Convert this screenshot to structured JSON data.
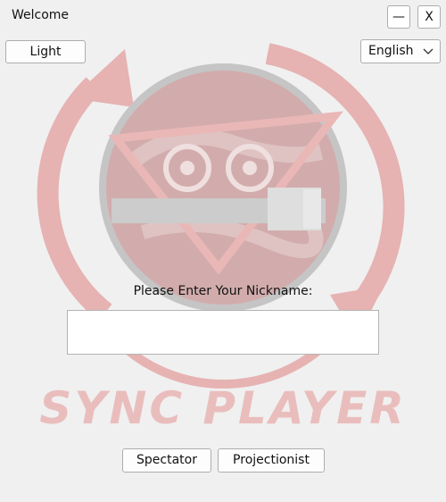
{
  "window": {
    "title": "Welcome",
    "minimize_label": "—",
    "close_label": "X"
  },
  "toolbar": {
    "theme_button_label": "Light",
    "language_selected": "English"
  },
  "form": {
    "prompt": "Please Enter Your Nickname:",
    "nickname_value": "",
    "nickname_placeholder": ""
  },
  "brand": {
    "text": "SYNC PLAYER",
    "color": "#dc5050"
  },
  "actions": {
    "spectator_label": "Spectator",
    "projectionist_label": "Projectionist"
  },
  "icons": {
    "language_dropdown": "chevron-down-icon",
    "logo": "sync-player-logo"
  }
}
